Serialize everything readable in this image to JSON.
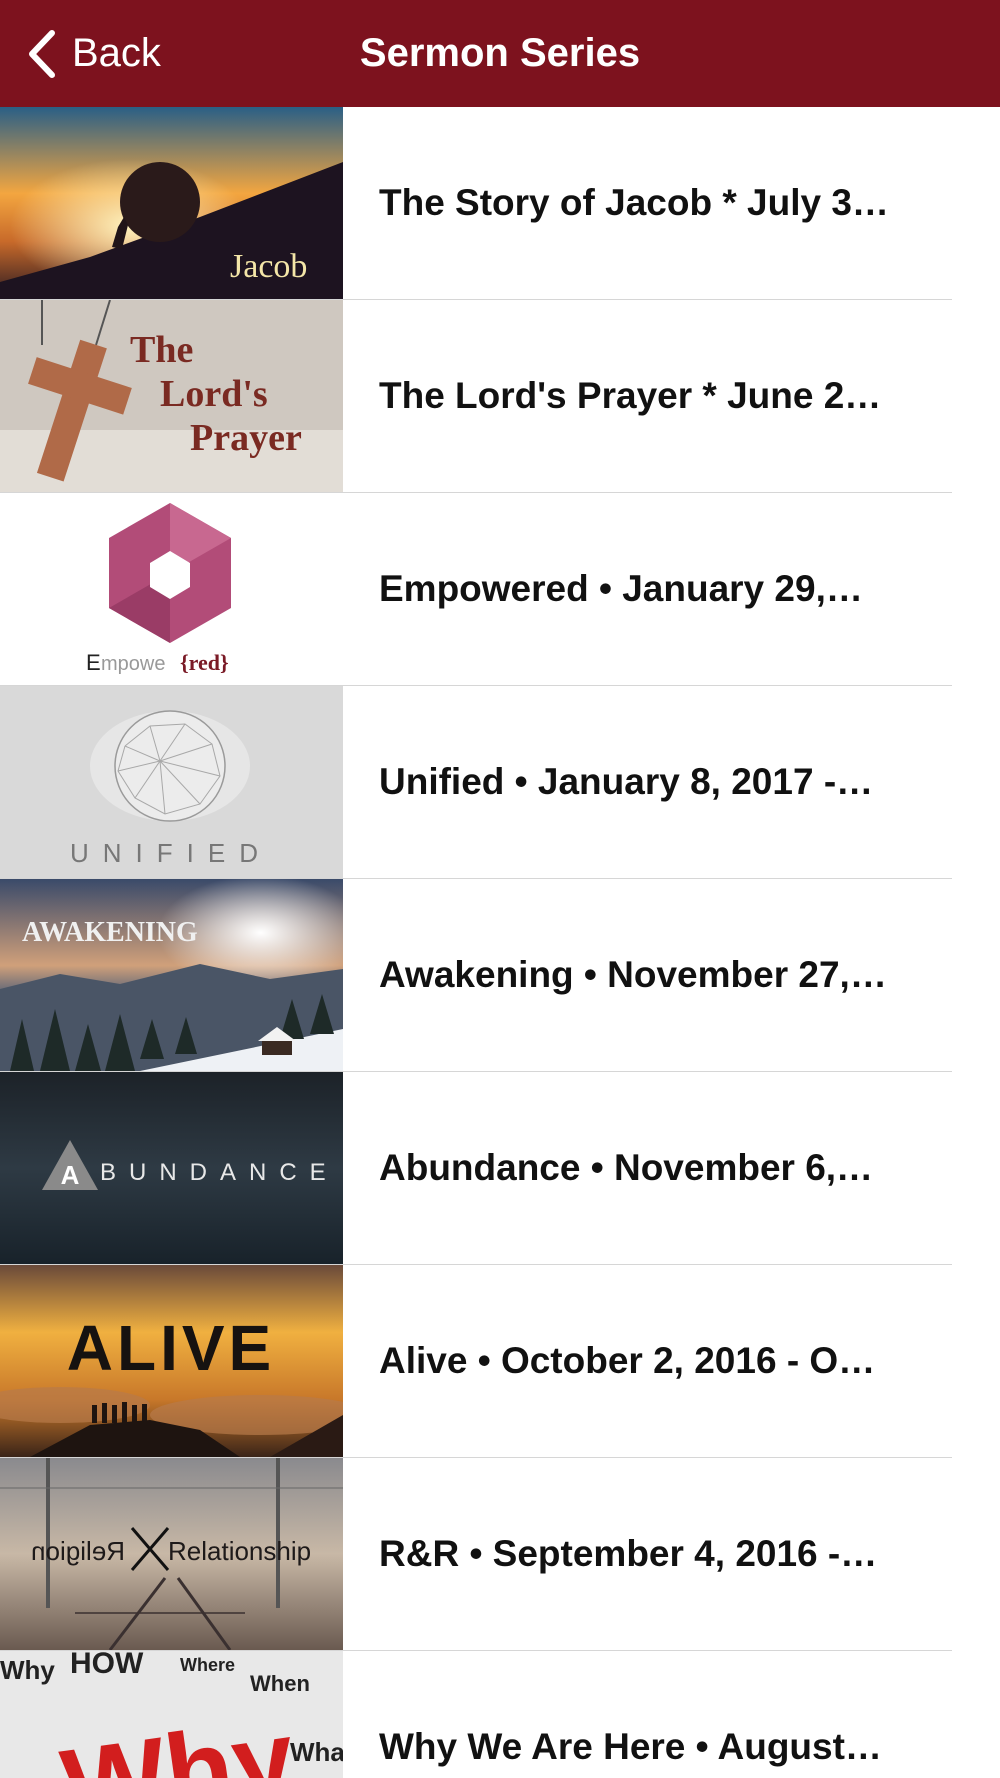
{
  "nav": {
    "back_label": "Back",
    "title": "Sermon Series",
    "bar_color": "#7d121e"
  },
  "series": [
    {
      "title": "The Story of Jacob * July 3…",
      "thumb_icon": "jacob-sunset-boulder-image",
      "thumb_text": "Jacob"
    },
    {
      "title": "The Lord's Prayer * June 2…",
      "thumb_icon": "wooden-cross-image",
      "thumb_text": "The Lord's Prayer"
    },
    {
      "title": "Empowered • January 29,…",
      "thumb_icon": "pink-hexagon-image",
      "thumb_text": "Empowe{red}"
    },
    {
      "title": "Unified • January 8, 2017 -…",
      "thumb_icon": "geodesic-sphere-image",
      "thumb_text": "UNIFIED"
    },
    {
      "title": "Awakening • November 27,…",
      "thumb_icon": "snowy-forest-sunrise-image",
      "thumb_text": "AWAKENING"
    },
    {
      "title": "Abundance • November 6,…",
      "thumb_icon": "dark-ocean-image",
      "thumb_text": "ABUNDANCE"
    },
    {
      "title": "Alive • October 2, 2016 - O…",
      "thumb_icon": "sunset-cloud-silhouettes-image",
      "thumb_text": "ALIVE"
    },
    {
      "title": "R&R • September 4, 2016 -…",
      "thumb_icon": "railroad-tracks-image",
      "thumb_text": "Religion Relationship"
    },
    {
      "title": "Why We Are Here • August…",
      "thumb_icon": "word-collage-why-image",
      "thumb_text": "Why"
    }
  ]
}
